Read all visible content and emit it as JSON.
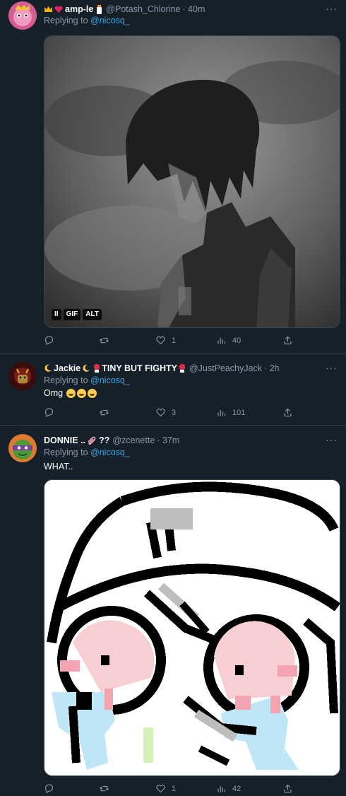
{
  "tweets": [
    {
      "display_name": "amp-le",
      "name_prefix_icons": [
        "crown-icon",
        "heart-icon"
      ],
      "name_suffix_icon": "milk-bottle-icon",
      "handle": "@Potash_Chlorine",
      "time": "· 40m",
      "reply_prefix": "Replying to",
      "reply_to": "@nicosq_",
      "media_badges": [
        "II",
        "GIF",
        "ALT"
      ],
      "actions": {
        "reply": "",
        "retweet": "",
        "like": "1",
        "views": "40"
      }
    },
    {
      "display_name": "Jackie",
      "name_extra": "TINY BUT FIGHTY",
      "name_icons": [
        "moon-icon",
        "moon-icon",
        "boxing-glove-icon",
        "boxing-glove-icon"
      ],
      "handle": "@JustPeachyJack",
      "time": "· 2h",
      "reply_prefix": "Replying to",
      "reply_to": "@nicosq_",
      "text": "Omg",
      "text_emojis": [
        "loudly-crying-face",
        "loudly-crying-face",
        "loudly-crying-face"
      ],
      "actions": {
        "reply": "",
        "retweet": "",
        "like": "3",
        "views": "101"
      }
    },
    {
      "display_name": "DONNIE ..",
      "name_extra": "??",
      "name_icons": [
        "paperclip-icon"
      ],
      "handle": "@zcenette",
      "time": "· 37m",
      "reply_prefix": "Replying to",
      "reply_to": "@nicosq_",
      "text": "WHAT..",
      "actions": {
        "reply": "",
        "retweet": "",
        "like": "1",
        "views": "42"
      }
    }
  ],
  "more_label": "···",
  "colors": {
    "background": "#15202b",
    "divider": "#38444d",
    "secondary_text": "#8b98a5",
    "mention": "#3aa4dd"
  }
}
